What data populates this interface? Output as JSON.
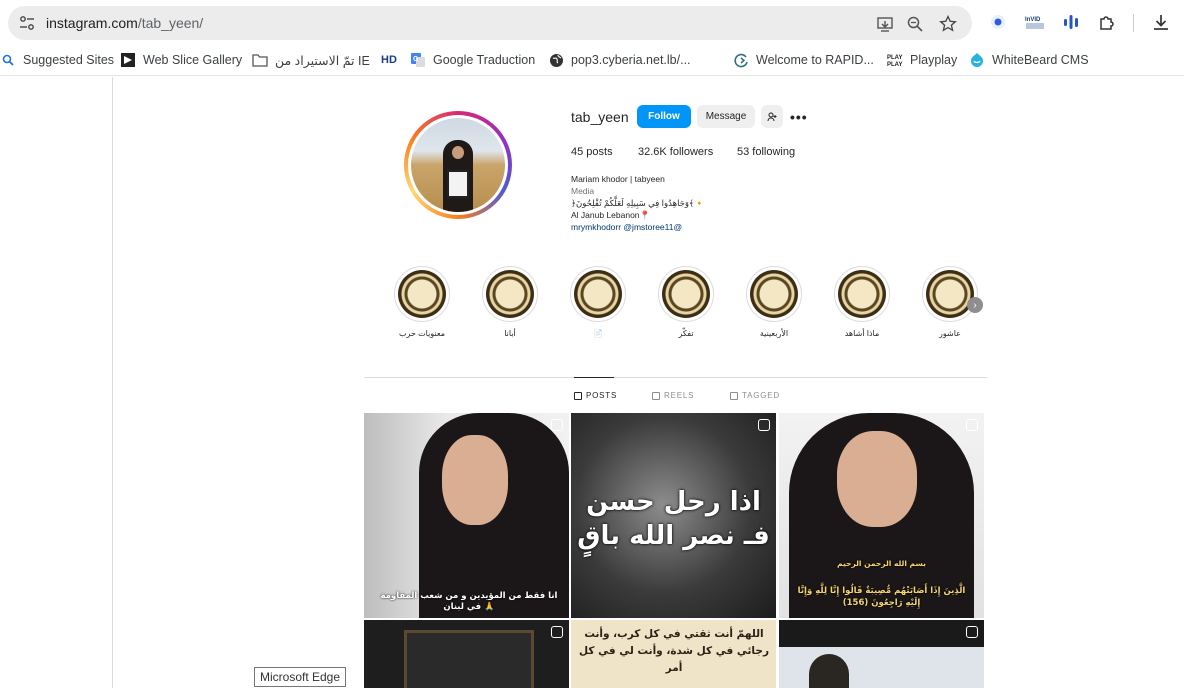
{
  "browser": {
    "url_host": "instagram.com",
    "url_path": "/tab_yeen/",
    "tooltip": "Microsoft Edge"
  },
  "bookmarks": [
    {
      "label": "Suggested Sites",
      "icon": "search-icon"
    },
    {
      "label": "Web Slice Gallery",
      "icon": "slice-icon"
    },
    {
      "label": "تمّ الاستيراد من IE",
      "icon": "folder-icon"
    },
    {
      "label": "",
      "icon": "hd-icon"
    },
    {
      "label": "Google Traduction",
      "icon": "translate-icon"
    },
    {
      "label": "pop3.cyberia.net.lb/...",
      "icon": "globe-icon"
    },
    {
      "label": "Welcome to RAPID...",
      "icon": "rapid-icon"
    },
    {
      "label": "Playplay",
      "icon": "playplay-icon"
    },
    {
      "label": "WhiteBeard CMS",
      "icon": "whitebeard-icon"
    }
  ],
  "profile": {
    "username": "tab_yeen",
    "follow_label": "Follow",
    "message_label": "Message",
    "posts": "45 posts",
    "followers": "32.6K followers",
    "following": "53 following",
    "name": "Mariam khodor | tabyeen",
    "category": "Media",
    "bio_line1": "﴿وَجَاهِدُوا فِي سَبِيلِهِ لَعَلَّكُمْ تُفْلِحُونَ﴾🔸",
    "bio_line2": "Al Janub Lebanon📍",
    "bio_links": "mrymkhodorr @jmstoree11@"
  },
  "highlights": [
    {
      "label": "معنويات حرب"
    },
    {
      "label": "أبانا"
    },
    {
      "label": "📄"
    },
    {
      "label": "تفكّر"
    },
    {
      "label": "الأربعينية"
    },
    {
      "label": "ماذا أشاهد"
    },
    {
      "label": "عاشور"
    }
  ],
  "tabs": [
    {
      "label": "POSTS"
    },
    {
      "label": "REELS"
    },
    {
      "label": "TAGGED"
    }
  ],
  "posts": {
    "p1_caption": "انا فقط من المؤيدين و من شعب المقاومة في لبنان 🙏",
    "p2_caption": "اذا رحل حسن فـ نصر الله باقٍ",
    "p3_caption_top": "بسم الله الرحمن الرحيم",
    "p3_caption": "الَّذِينَ إِذَا أَصَابَتْهُم مُّصِيبَةٌ قَالُوا إِنَّا لِلَّهِ وَإِنَّا إِلَيْهِ رَاجِعُونَ (156)",
    "p5_caption": "اللهمّ أنت ثقتي في كل كرب، وأنت رجائي في كل شدة، وأنت لي في كل أمر"
  }
}
